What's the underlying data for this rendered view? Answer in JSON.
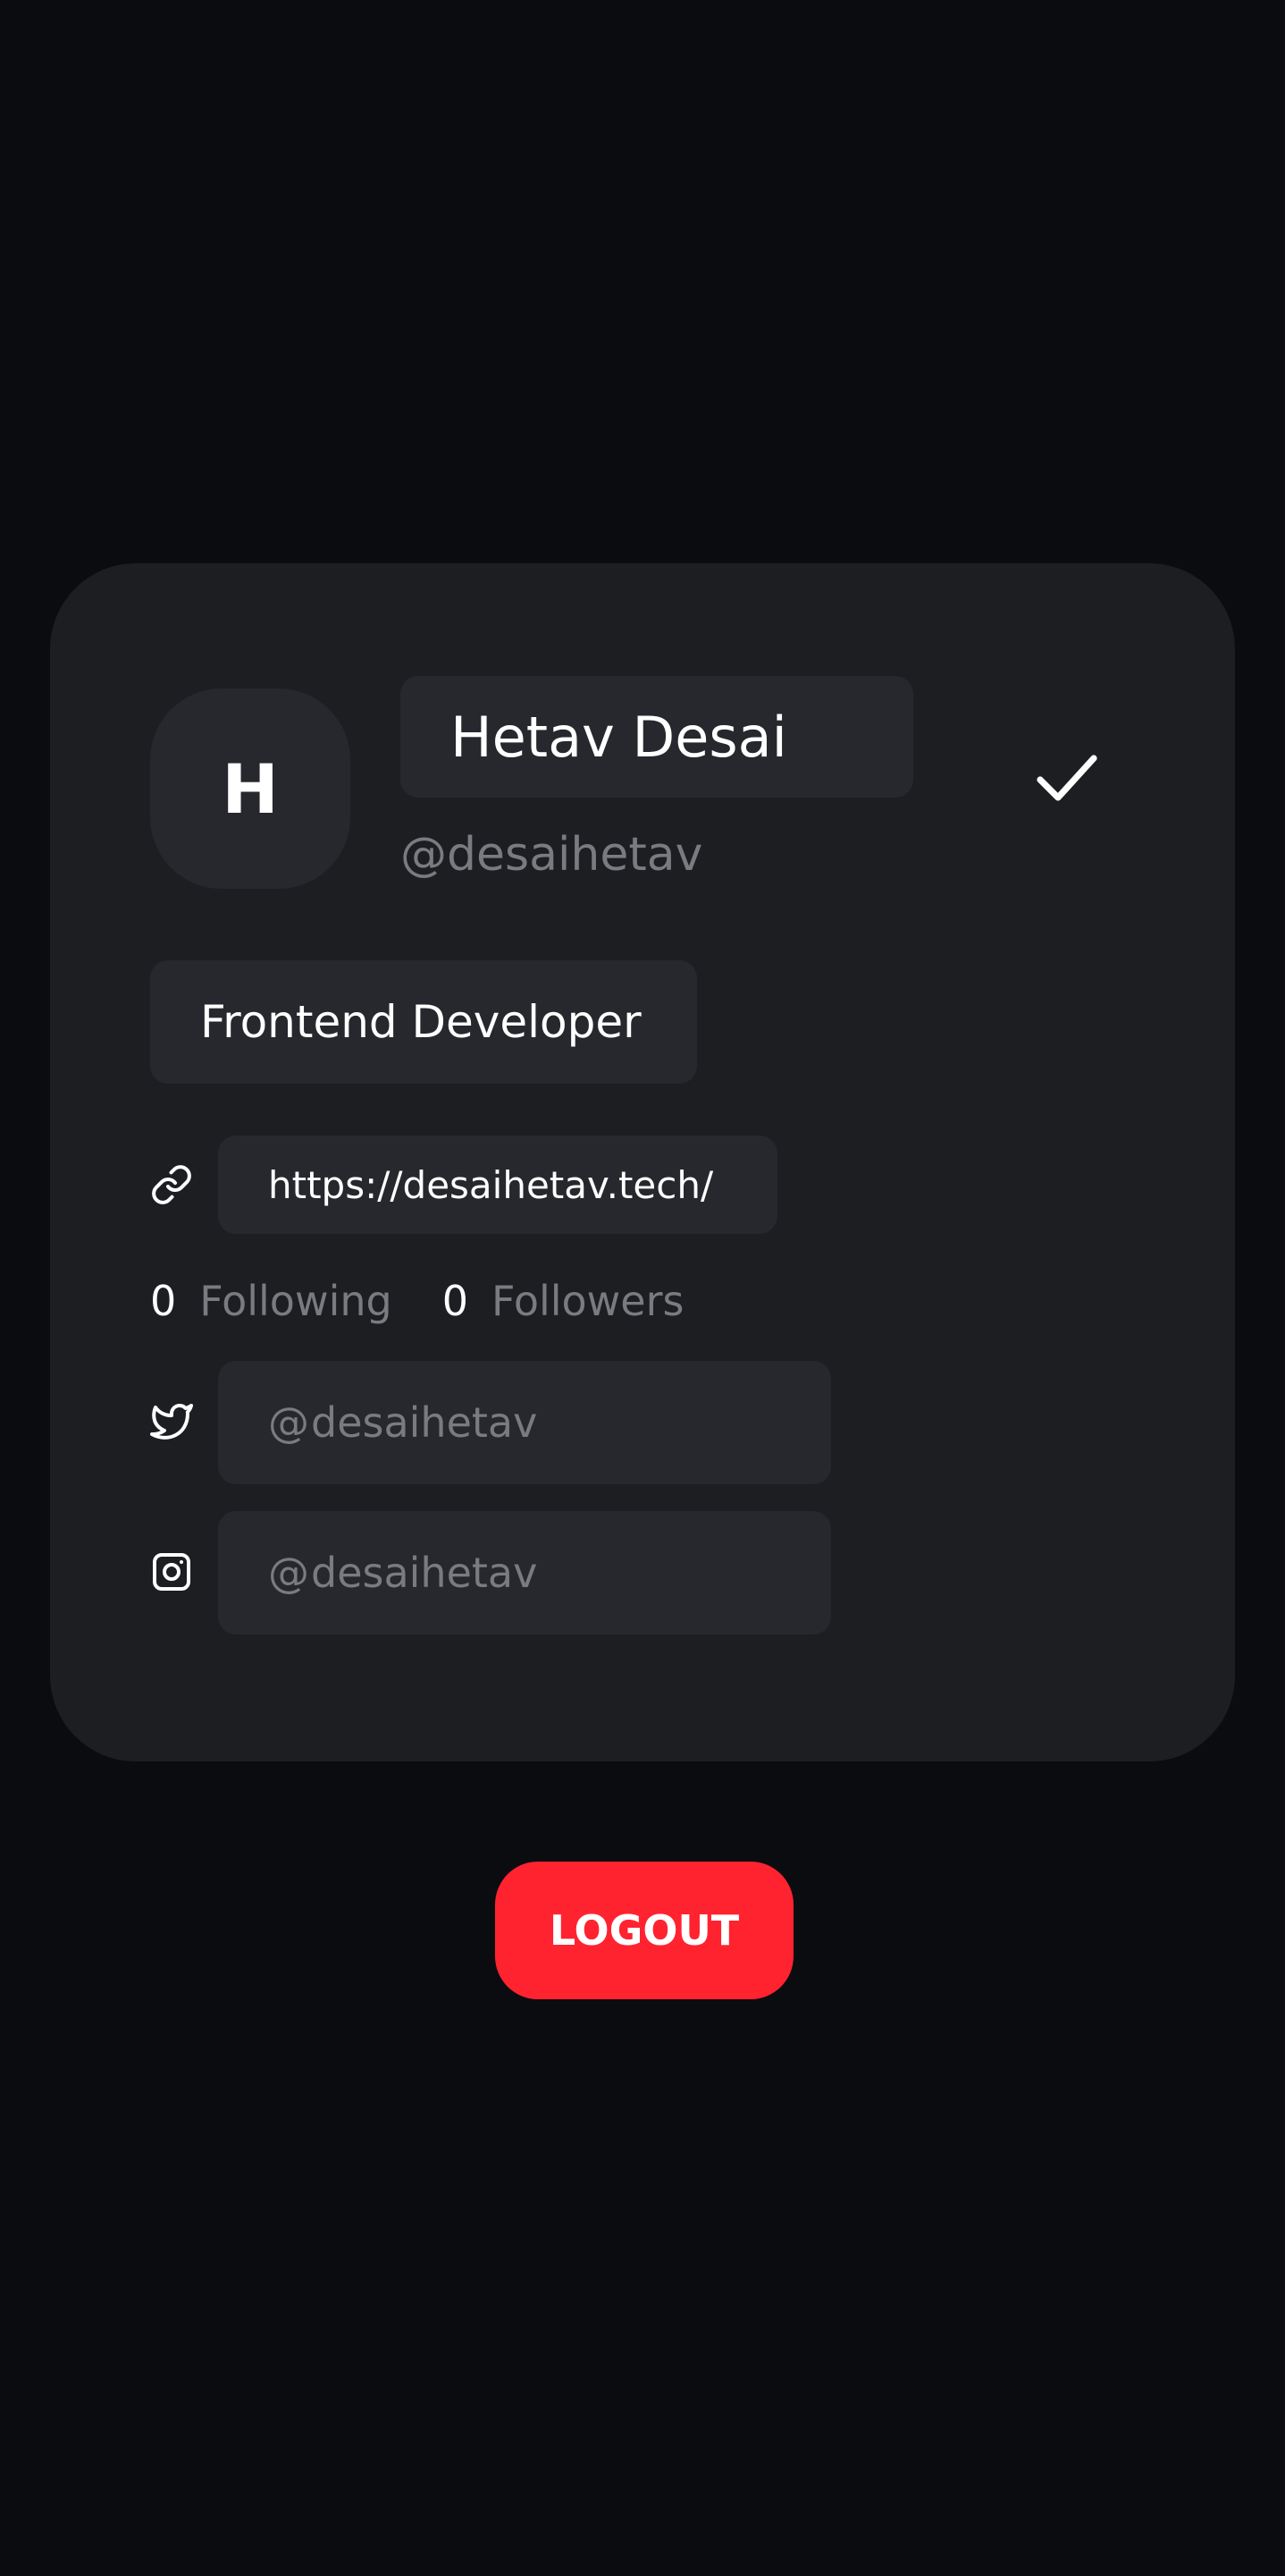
{
  "profile": {
    "avatar_initial": "H",
    "name": "Hetav Desai",
    "handle": "@desaihetav",
    "bio": "Frontend Developer",
    "website": "https://desaihetav.tech/"
  },
  "stats": {
    "following_count": "0",
    "following_label": "Following",
    "followers_count": "0",
    "followers_label": "Followers"
  },
  "social": {
    "at_symbol": "@",
    "twitter": "desaihetav",
    "instagram": "desaihetav"
  },
  "actions": {
    "logout_label": "LOGOUT"
  },
  "icons": {
    "save": "check-icon",
    "website": "link-icon",
    "twitter": "twitter-icon",
    "instagram": "instagram-icon"
  },
  "colors": {
    "background": "#0b0c10",
    "card": "#1d1e22",
    "field": "#27282d",
    "muted_text": "#7a7b80",
    "logout": "#ff2330"
  }
}
